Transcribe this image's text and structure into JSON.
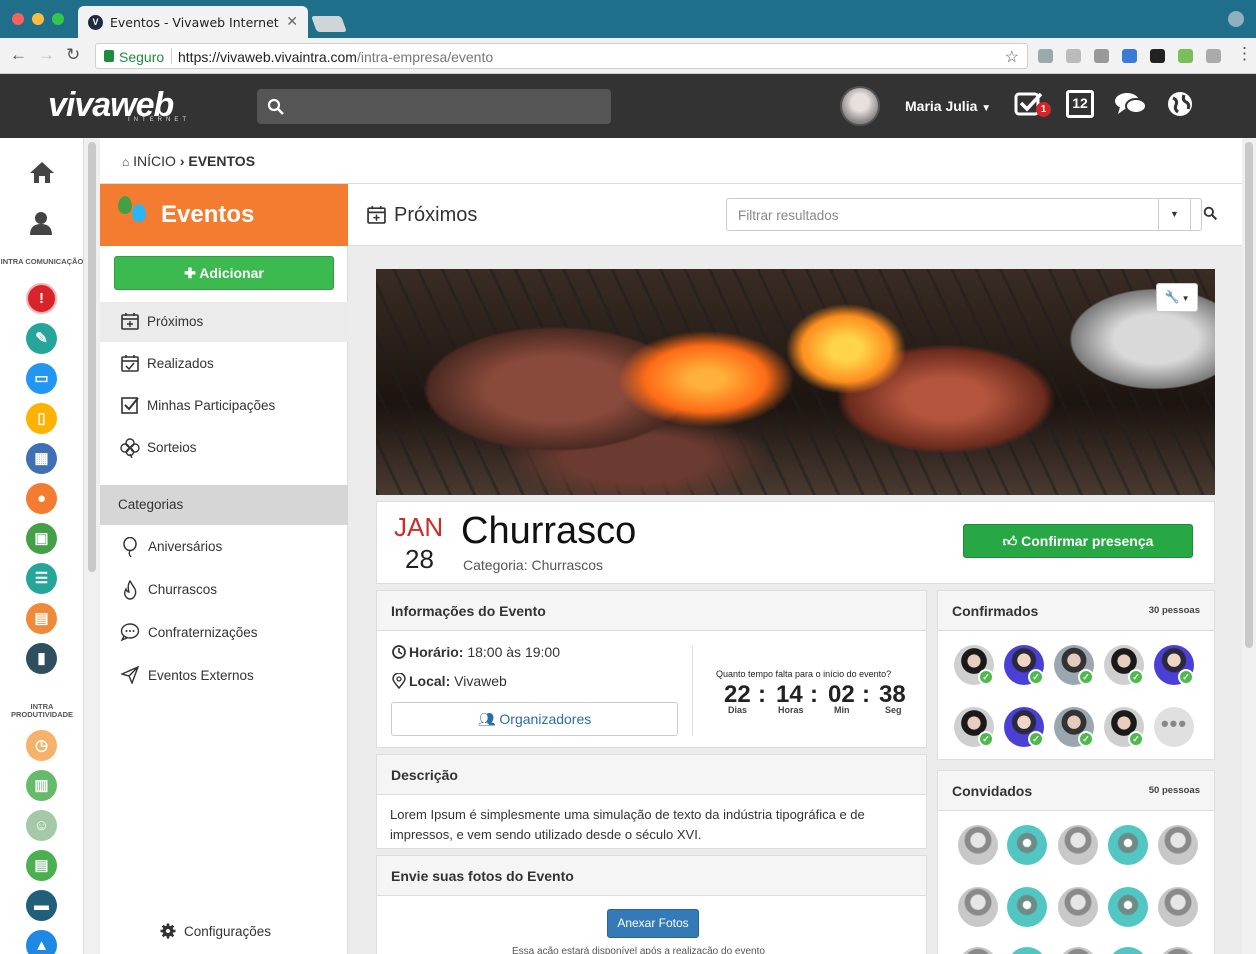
{
  "browser": {
    "tab_title": "Eventos - Vivaweb Internet",
    "url_secure": "Seguro",
    "url_host": "https://vivaweb.vivaintra.com",
    "url_path": "/intra-empresa/evento"
  },
  "header": {
    "logo": "vivaweb",
    "logo_sub": "INTERNET",
    "user_name": "Maria Julia",
    "tasks_badge": "1",
    "calendar_day": "12"
  },
  "rail": {
    "group_comunicacao": "INTRA COMUNICAÇÃO",
    "group_produtividade": "INTRA PRODUTIVIDADE"
  },
  "breadcrumb": {
    "home": "INÍCIO",
    "current": "EVENTOS"
  },
  "sidebar": {
    "title": "Eventos",
    "add_label": "Adicionar",
    "items": [
      {
        "label": "Próximos"
      },
      {
        "label": "Realizados"
      },
      {
        "label": "Minhas Participações"
      },
      {
        "label": "Sorteios"
      }
    ],
    "categories_label": "Categorias",
    "categories": [
      {
        "label": "Aniversários"
      },
      {
        "label": "Churrascos"
      },
      {
        "label": "Confraternizações"
      },
      {
        "label": "Eventos Externos"
      }
    ],
    "config_label": "Configurações"
  },
  "main": {
    "title": "Próximos",
    "filter_placeholder": "Filtrar resultados"
  },
  "event": {
    "month": "JAN",
    "day": "28",
    "title": "Churrasco",
    "category": "Categoria: Churrascos",
    "confirm_label": "Confirmar presença"
  },
  "info": {
    "title": "Informações do Evento",
    "time_label": "Horário:",
    "time_value": "18:00 às 19:00",
    "place_label": "Local:",
    "place_value": "Vivaweb",
    "organizers_label": "Organizadores",
    "countdown_question": "Quanto tempo falta para o início do evento?",
    "countdown": {
      "days": "22",
      "hours": "14",
      "min": "02",
      "sec": "38",
      "days_label": "Dias",
      "hours_label": "Horas",
      "min_label": "Min",
      "sec_label": "Seg"
    }
  },
  "description": {
    "title": "Descrição",
    "text": "Lorem Ipsum é simplesmente uma simulação de texto da indústria tipográfica e de impressos, e vem sendo utilizado desde o século XVI."
  },
  "photos": {
    "title": "Envie suas fotos do Evento",
    "button": "Anexar Fotos",
    "note": "Essa ação estará disponível após a realização do evento"
  },
  "confirmados": {
    "title": "Confirmados",
    "count": "30 pessoas"
  },
  "convidados": {
    "title": "Convidados",
    "count": "50 pessoas"
  },
  "colors": {
    "brand_orange": "#f47c30",
    "header_dark": "#333333",
    "success_green": "#28a745",
    "date_red": "#c9302c"
  }
}
